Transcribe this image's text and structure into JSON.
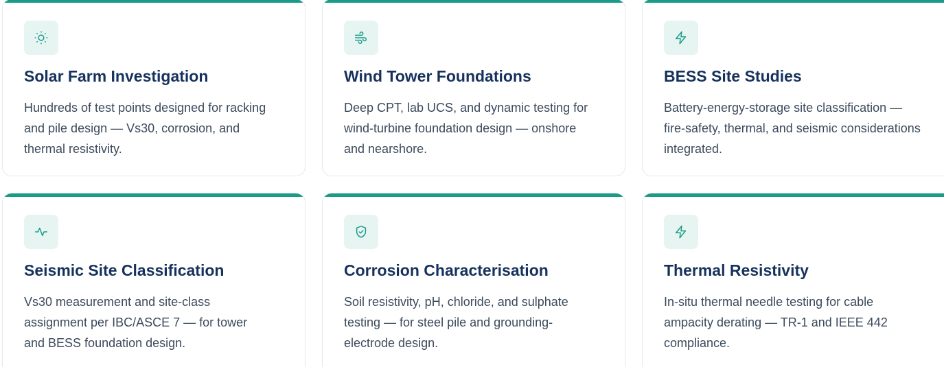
{
  "accent_color": "#1a9a88",
  "title_color": "#16325c",
  "cards": [
    {
      "icon": "sun-icon",
      "title": "Solar Farm Investigation",
      "description": "Hundreds of test points designed for racking and pile design — Vs30, corrosion, and thermal resistivity."
    },
    {
      "icon": "wind-icon",
      "title": "Wind Tower Foundations",
      "description": "Deep CPT, lab UCS, and dynamic testing for wind-turbine foundation design — onshore and nearshore."
    },
    {
      "icon": "lightning-icon",
      "title": "BESS Site Studies",
      "description": "Battery-energy-storage site classification — fire-safety, thermal, and seismic considerations integrated."
    },
    {
      "icon": "activity-pulse-icon",
      "title": "Seismic Site Classification",
      "description": "Vs30 measurement and site-class assignment per IBC/ASCE 7 — for tower and BESS foundation design."
    },
    {
      "icon": "shield-check-icon",
      "title": "Corrosion Characterisation",
      "description": "Soil resistivity, pH, chloride, and sulphate testing — for steel pile and grounding-electrode design."
    },
    {
      "icon": "lightning-icon",
      "title": "Thermal Resistivity",
      "description": "In-situ thermal needle testing for cable ampacity derating — TR-1 and IEEE 442 compliance."
    }
  ]
}
